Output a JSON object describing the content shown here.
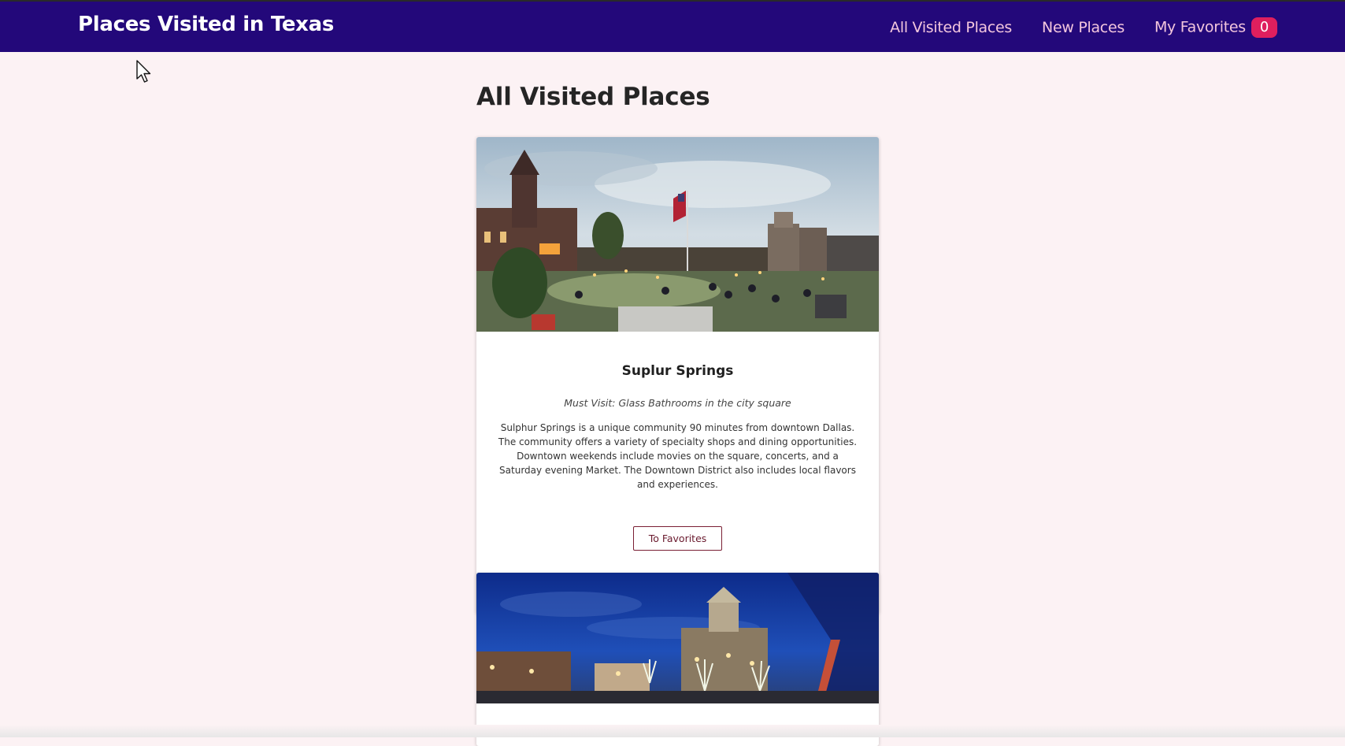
{
  "header": {
    "title": "Places Visited in Texas",
    "nav": [
      {
        "label": "All Visited Places"
      },
      {
        "label": "New Places"
      },
      {
        "label": "My Favorites"
      }
    ],
    "favorites_count": "0"
  },
  "main": {
    "title": "All Visited Places",
    "places": [
      {
        "name": "Suplur Springs",
        "must_visit": "Must Visit: Glass Bathrooms in the city square",
        "description": "Sulphur Springs is a unique community 90 minutes from downtown Dallas. The community offers a variety of specialty shops and dining opportunities. Downtown weekends include movies on the square, concerts, and a Saturday evening Market. The Downtown District also includes local flavors and experiences.",
        "button_label": "To Favorites"
      }
    ]
  },
  "colors": {
    "header_bg": "#23087a",
    "page_bg": "#fcf2f4",
    "badge": "#df1f5e",
    "nav_text": "#f3c6dd",
    "button_border": "#7a1f34"
  }
}
